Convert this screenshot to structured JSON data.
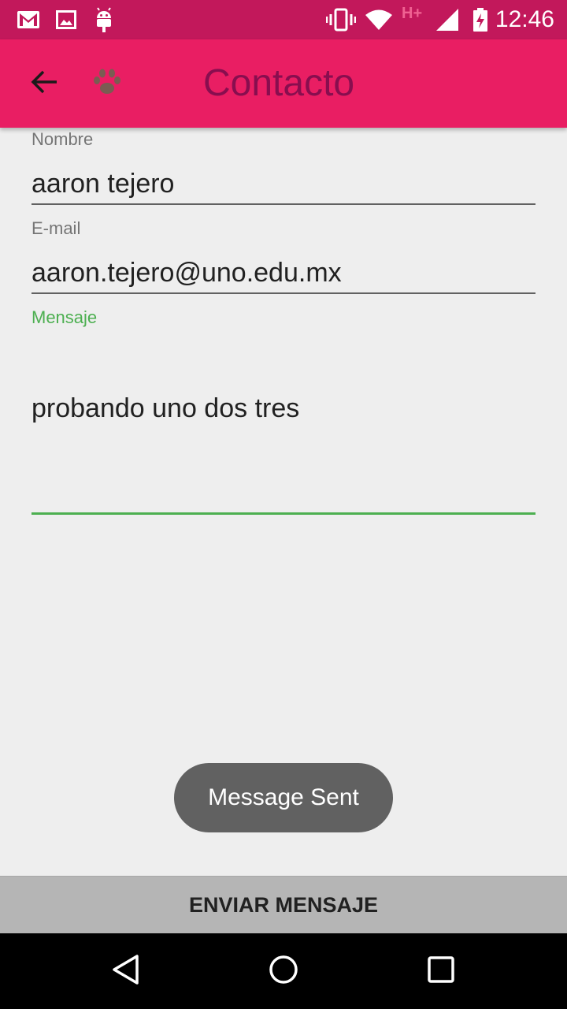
{
  "status_bar": {
    "time": "12:46",
    "network_type": "H+",
    "icons": [
      "gmail-icon",
      "image-icon",
      "android-icon",
      "vibrate-icon",
      "wifi-icon",
      "signal-icon",
      "battery-charging-icon"
    ]
  },
  "toolbar": {
    "title": "Contacto",
    "back_icon": "arrow-left-icon",
    "logo_icon": "paw-icon"
  },
  "form": {
    "name_label": "Nombre",
    "name_value": "aaron tejero",
    "email_label": "E-mail",
    "email_value": "aaron.tejero@uno.edu.mx",
    "message_label": "Mensaje",
    "message_value": "probando uno dos tres"
  },
  "toast": {
    "text": "Message Sent"
  },
  "send_button": {
    "label": "ENVIAR MENSAJE"
  },
  "colors": {
    "status_bar": "#c2185b",
    "toolbar": "#e91e63",
    "title": "#880e4f",
    "focus_accent": "#4caf50",
    "background": "#eeeeee",
    "button": "#b5b5b5"
  }
}
